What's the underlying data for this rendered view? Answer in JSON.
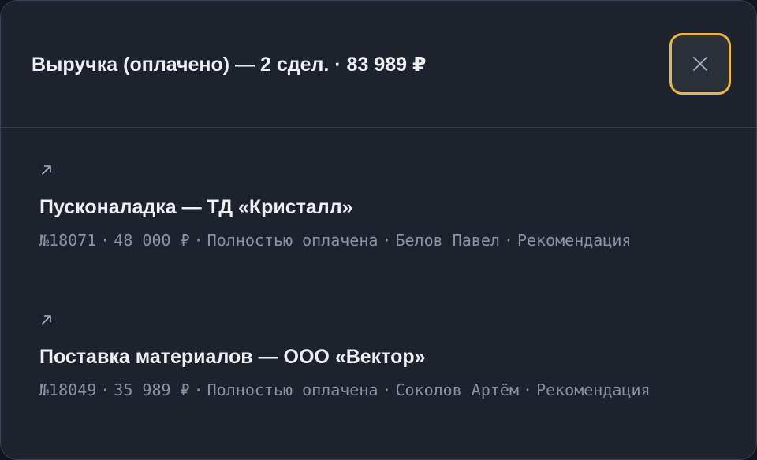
{
  "modal": {
    "title": "Выручка (оплачено) — 2 сдел. · 83 989 ₽",
    "close_icon": "close-icon",
    "colors": {
      "background": "#1e222d",
      "close_focus_ring": "#e6b83c",
      "title_text": "#eef0f4",
      "meta_text": "#8b93a3"
    }
  },
  "deals": [
    {
      "open_icon": "arrow-up-right-icon",
      "title": "Пусконаладка — ТД «Кристалл»",
      "number": "№18071",
      "amount": "48 000 ₽",
      "status": "Полностью оплачена",
      "manager": "Белов Павел",
      "source": "Рекомендация",
      "separator": "·"
    },
    {
      "open_icon": "arrow-up-right-icon",
      "title": "Поставка материалов — ООО «Вектор»",
      "number": "№18049",
      "amount": "35 989 ₽",
      "status": "Полностью оплачена",
      "manager": "Соколов Артём",
      "source": "Рекомендация",
      "separator": "·"
    }
  ]
}
